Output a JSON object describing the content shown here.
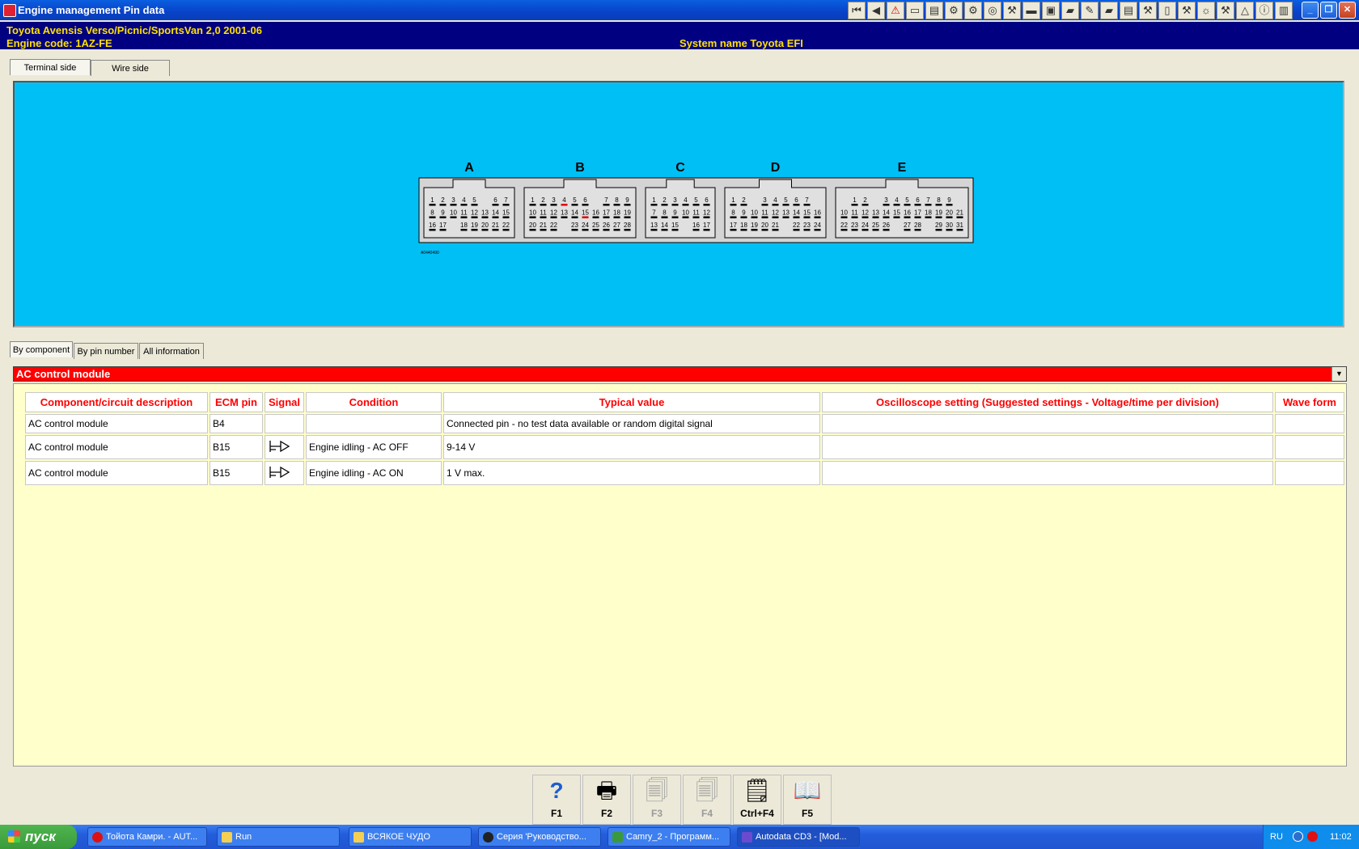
{
  "window": {
    "title": "Engine management Pin data"
  },
  "toolbar_icons": [
    "first-icon",
    "prev-icon",
    "warning-icon",
    "page-icon",
    "chart-icon",
    "gear-icon",
    "engine-icon",
    "tyre-icon",
    "tool-icon",
    "ruler-icon",
    "save-icon",
    "car-icon",
    "pen-icon",
    "car-icon",
    "document-icon",
    "tool-icon",
    "fuse-icon",
    "tool-icon",
    "lamp-icon",
    "tool-icon",
    "triangle-icon",
    "info-icon",
    "note-icon"
  ],
  "vehicle": {
    "make_model": "Toyota   Avensis Verso/Picnic/SportsVan  2,0  2001-06",
    "engine_code": "Engine code: 1AZ-FE",
    "system_name": "System name Toyota EFI"
  },
  "view_tabs": [
    "Terminal side",
    "Wire side"
  ],
  "connector": {
    "groups": [
      {
        "letter": "A",
        "rows": [
          [
            "1",
            "2",
            "3",
            "4",
            "5",
            "",
            "6",
            "7"
          ],
          [
            "8",
            "9",
            "10",
            "11",
            "12",
            "13",
            "14",
            "15"
          ],
          [
            "16",
            "17",
            "",
            "18",
            "19",
            "20",
            "21",
            "22"
          ]
        ]
      },
      {
        "letter": "B",
        "rows": [
          [
            "1",
            "2",
            "3",
            "4",
            "5",
            "6",
            "",
            "7",
            "8",
            "9"
          ],
          [
            "10",
            "11",
            "12",
            "13",
            "14",
            "15",
            "16",
            "17",
            "18",
            "19"
          ],
          [
            "20",
            "21",
            "22",
            "",
            "23",
            "24",
            "25",
            "26",
            "27",
            "28"
          ]
        ]
      },
      {
        "letter": "C",
        "rows": [
          [
            "1",
            "2",
            "3",
            "4",
            "5",
            "6"
          ],
          [
            "7",
            "8",
            "9",
            "10",
            "11",
            "12"
          ],
          [
            "13",
            "14",
            "15",
            "",
            "16",
            "17"
          ]
        ]
      },
      {
        "letter": "D",
        "rows": [
          [
            "1",
            "2",
            "",
            "3",
            "4",
            "5",
            "6",
            "7",
            ""
          ],
          [
            "8",
            "9",
            "10",
            "11",
            "12",
            "13",
            "14",
            "15",
            "16"
          ],
          [
            "17",
            "18",
            "19",
            "20",
            "21",
            "",
            "22",
            "23",
            "24"
          ]
        ]
      },
      {
        "letter": "E",
        "rows": [
          [
            "",
            "1",
            "2",
            "",
            "3",
            "4",
            "5",
            "6",
            "7",
            "8",
            "9",
            ""
          ],
          [
            "10",
            "11",
            "12",
            "13",
            "14",
            "15",
            "16",
            "17",
            "18",
            "19",
            "20",
            "21"
          ],
          [
            "22",
            "23",
            "24",
            "25",
            "26",
            "",
            "27",
            "28",
            "",
            "29",
            "30",
            "31"
          ]
        ]
      }
    ],
    "highlighted": [
      "B4",
      "B15"
    ],
    "diagram_ref": "A0440490"
  },
  "list_tabs": [
    "By component",
    "By pin number",
    "All information"
  ],
  "selected_component": "AC control module",
  "table": {
    "headers": [
      "Component/circuit description",
      "ECM pin",
      "Signal",
      "Condition",
      "Typical value",
      "Oscilloscope setting (Suggested settings - Voltage/time per division)",
      "Wave form"
    ],
    "rows": [
      {
        "description": "AC control module",
        "pin": "B4",
        "signal": "",
        "condition": "",
        "typical": "Connected pin - no test data available or random digital signal",
        "oscilloscope": "",
        "waveform": ""
      },
      {
        "description": "AC control module",
        "pin": "B15",
        "signal": "output-signal-icon",
        "condition": "Engine idling - AC OFF",
        "typical": "9-14 V",
        "oscilloscope": "",
        "waveform": ""
      },
      {
        "description": "AC control module",
        "pin": "B15",
        "signal": "output-signal-icon",
        "condition": "Engine idling - AC ON",
        "typical": "1 V max.",
        "oscilloscope": "",
        "waveform": ""
      }
    ]
  },
  "function_keys": [
    {
      "label": "F1",
      "icon": "help-icon",
      "enabled": true
    },
    {
      "label": "F2",
      "icon": "printer-icon",
      "enabled": true
    },
    {
      "label": "F3",
      "icon": "print-preview-icon",
      "enabled": false
    },
    {
      "label": "F4",
      "icon": "print-setup-icon",
      "enabled": false
    },
    {
      "label": "Ctrl+F4",
      "icon": "notes-icon",
      "enabled": true
    },
    {
      "label": "F5",
      "icon": "book-icon",
      "enabled": true
    }
  ],
  "taskbar": {
    "start_label": "пуск",
    "tasks": [
      "Тойота Камри. - AUT...",
      "Run",
      "ВСЯКОЕ ЧУДО",
      "Серия 'Руководство...",
      "Camry_2 - Программ...",
      "Autodata CD3 - [Mod..."
    ],
    "language": "RU",
    "clock": "11:02"
  }
}
